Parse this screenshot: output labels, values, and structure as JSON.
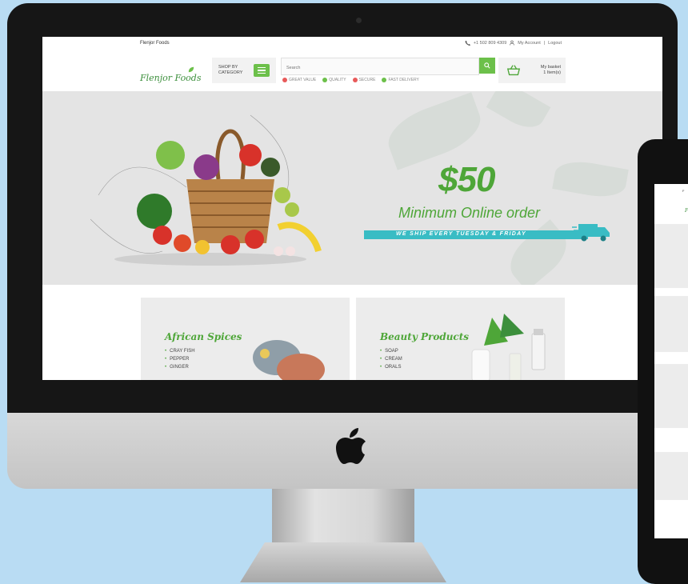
{
  "site": {
    "brand_small": "Flenjor Foods",
    "logo_text": "Flenjor Foods",
    "phone": "+1 502 809 4309",
    "my_account": "My Account",
    "separator": "|",
    "logout": "Logout"
  },
  "header": {
    "shop_by_category": "SHOP BY CATEGORY",
    "search_placeholder": "Search",
    "badges": [
      {
        "label": "GREAT VALUE",
        "color": "#e85a5a"
      },
      {
        "label": "QUALITY",
        "color": "#6cc04a"
      },
      {
        "label": "SECURE",
        "color": "#e85a5a"
      },
      {
        "label": "FAST DELIVERY",
        "color": "#6cc04a"
      }
    ],
    "basket_label": "My basket",
    "basket_count": "1 Item(s)"
  },
  "hero": {
    "amount": "$50",
    "subtitle": "Minimum Online order",
    "bar_text": "WE SHIP EVERY TUESDAY & FRIDAY"
  },
  "categories": [
    {
      "title": "African Spices",
      "items": [
        "CRAY FISH",
        "PEPPER",
        "GINGER"
      ]
    },
    {
      "title": "Beauty Products",
      "items": [
        "SOAP",
        "CREAM",
        "ORALS"
      ]
    }
  ],
  "tablet": {
    "brand_small": "F",
    "logo_text": "F"
  },
  "colors": {
    "brand_green": "#6cc04a",
    "promo_green": "#4ea638",
    "banner_teal": "#39bcc4",
    "background": "#b9dcf3"
  }
}
